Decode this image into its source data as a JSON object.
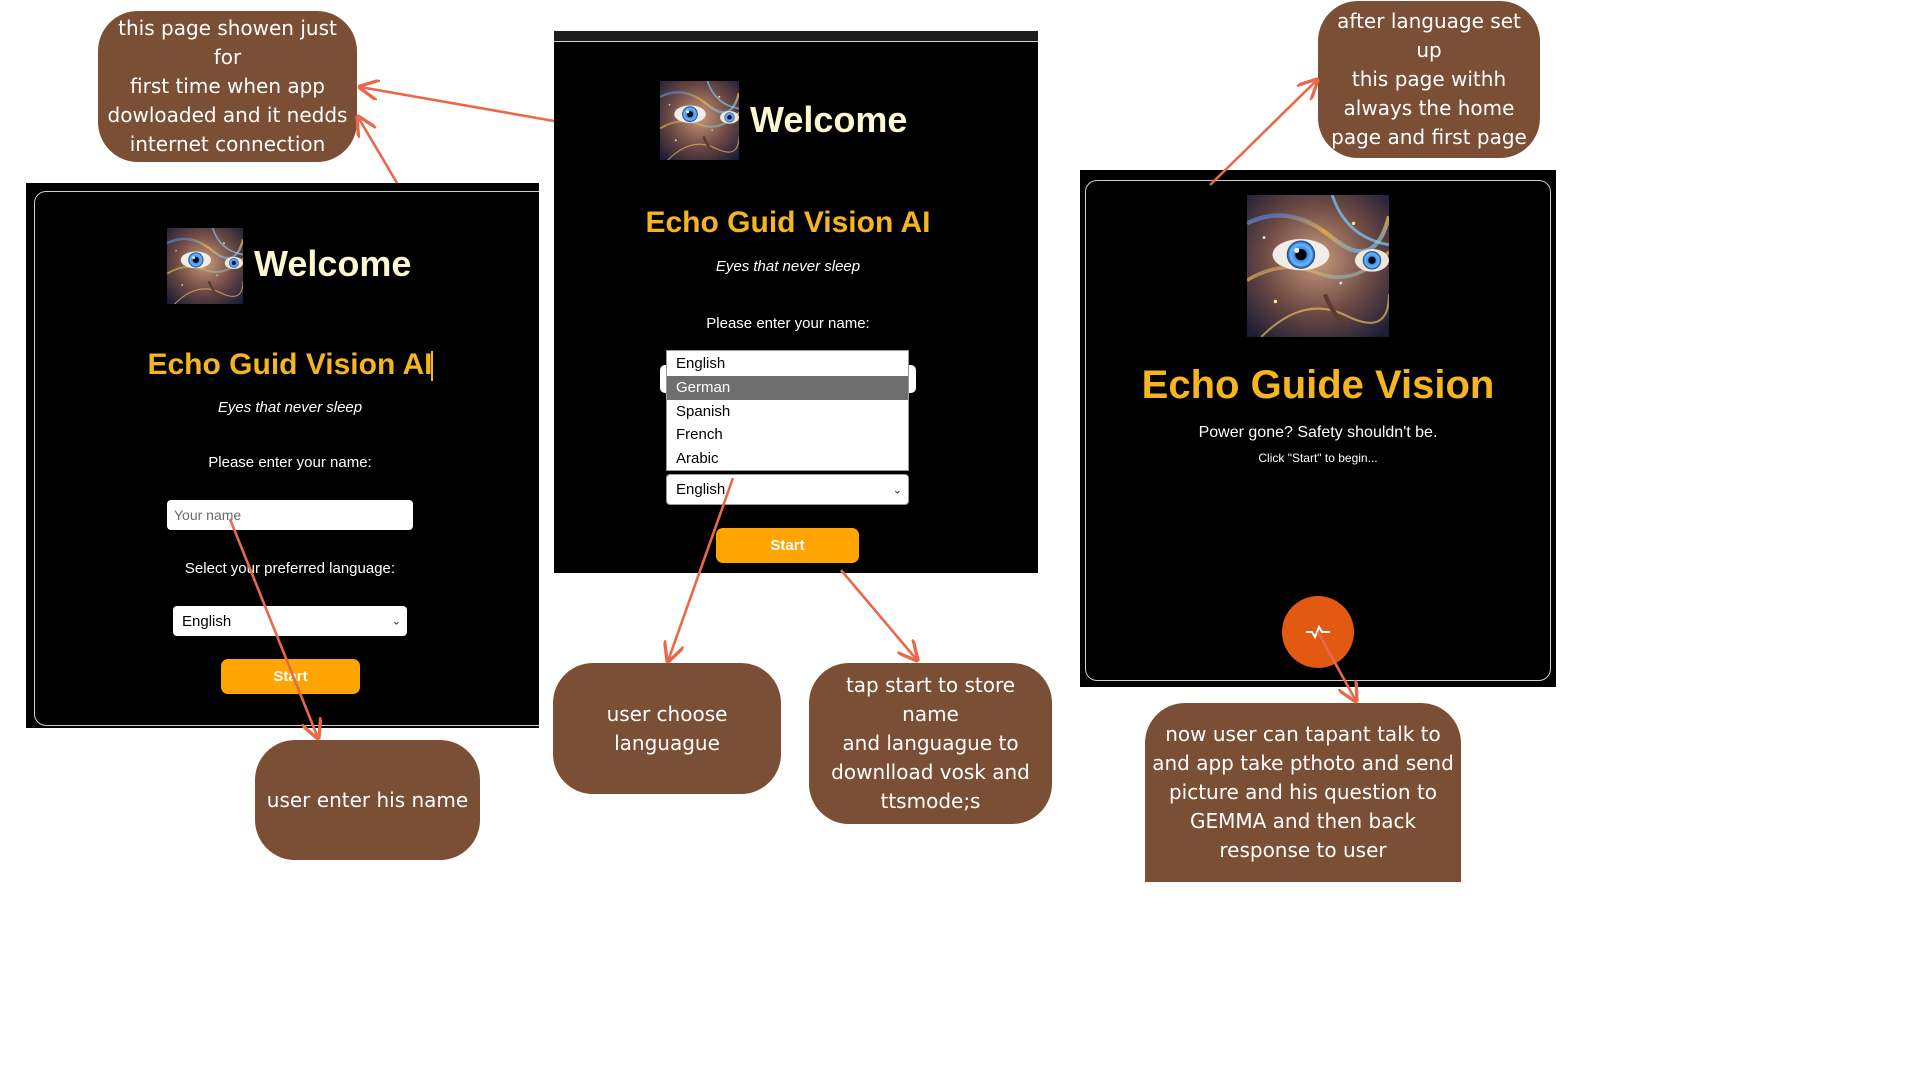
{
  "notes": {
    "first_time": "this page showen just for\nfirst time when app\ndowloaded and it nedds\ninternet connection",
    "home_page": "after language set up\nthis page withh\nalways the home\npage and first page",
    "enter_name": "user enter his name",
    "choose_language": "user choose\nlanguague",
    "tap_start": "tap start to store name\nand languague to\ndownlload vosk and\nttsmode;s",
    "talk": "now user can tapant talk to\nand app take pthoto and send\npicture and his question to\nGEMMA and then back\nresponse to user"
  },
  "screen_left": {
    "welcome": "Welcome",
    "app_title": "Echo Guid Vision AI",
    "tagline": "Eyes that never sleep",
    "name_prompt": "Please enter your name:",
    "name_placeholder": "Your name",
    "language_prompt": "Select your preferred language:",
    "language_value": "English",
    "start_label": "Start"
  },
  "screen_middle": {
    "welcome": "Welcome",
    "app_title": "Echo Guid Vision AI",
    "tagline": "Eyes that never sleep",
    "name_prompt": "Please enter your name:",
    "language_options": [
      "English",
      "German",
      "Spanish",
      "French",
      "Arabic"
    ],
    "highlighted_option": "German",
    "language_value": "English",
    "start_label": "Start"
  },
  "screen_right": {
    "app_title": "Echo Guide Vision",
    "subtitle": "Power gone? Safety shouldn't be.",
    "hint": "Click \"Start\" to begin...",
    "talk_button_icon": "pulse-icon"
  },
  "colors": {
    "bubble": "#7a4f35",
    "arrow": "#e8694a",
    "title_yellow": "#f5b520",
    "button_orange": "#ffa400",
    "talk_button": "#e25a12"
  }
}
